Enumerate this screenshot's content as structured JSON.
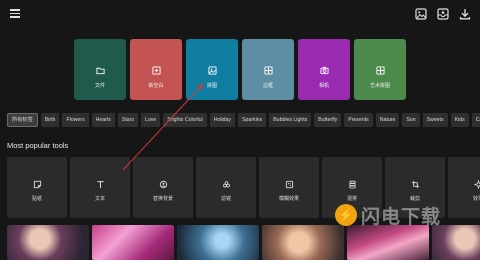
{
  "toolbar": {
    "icons": [
      "menu-icon",
      "gallery-icon",
      "inbox-icon",
      "download-icon"
    ]
  },
  "features": [
    {
      "label": "文件",
      "icon": "folder-icon",
      "color": "#1f5a4c"
    },
    {
      "label": "新空白",
      "icon": "add-box-icon",
      "color": "#c45353"
    },
    {
      "label": "拼图",
      "icon": "collage-icon",
      "color": "#0f7ea1"
    },
    {
      "label": "边框",
      "icon": "frame-icon",
      "color": "#5d8ea4"
    },
    {
      "label": "相机",
      "icon": "camera-icon",
      "color": "#9a2bb1"
    },
    {
      "label": "艺术拼图",
      "icon": "art-collage-icon",
      "color": "#4c8a4c"
    }
  ],
  "chips": [
    {
      "label": "所有标签",
      "active": true
    },
    {
      "label": "Birth"
    },
    {
      "label": "Flowers"
    },
    {
      "label": "Hearts"
    },
    {
      "label": "Stars"
    },
    {
      "label": "Love"
    },
    {
      "label": "Srights Colorful"
    },
    {
      "label": "Holiday"
    },
    {
      "label": "Sparkles"
    },
    {
      "label": "Bubbles Lights"
    },
    {
      "label": "Butterfly"
    },
    {
      "label": "Presents"
    },
    {
      "label": "Nature"
    },
    {
      "label": "Sun"
    },
    {
      "label": "Sweets"
    },
    {
      "label": "Kids"
    },
    {
      "label": "Cal"
    }
  ],
  "section": {
    "title": "Most popular tools"
  },
  "tools": [
    {
      "label": "贴纸",
      "icon": "sticker-icon"
    },
    {
      "label": "文本",
      "icon": "text-icon"
    },
    {
      "label": "替换背景",
      "icon": "replace-bg-icon"
    },
    {
      "label": "滤镜",
      "icon": "filter-icon"
    },
    {
      "label": "模糊效果",
      "icon": "blur-icon"
    },
    {
      "label": "混排",
      "icon": "layers-icon"
    },
    {
      "label": "裁剪",
      "icon": "crop-icon"
    },
    {
      "label": "效果",
      "icon": "effects-icon"
    }
  ],
  "watermark": {
    "logo": "⚡",
    "text": "闪电下载"
  }
}
